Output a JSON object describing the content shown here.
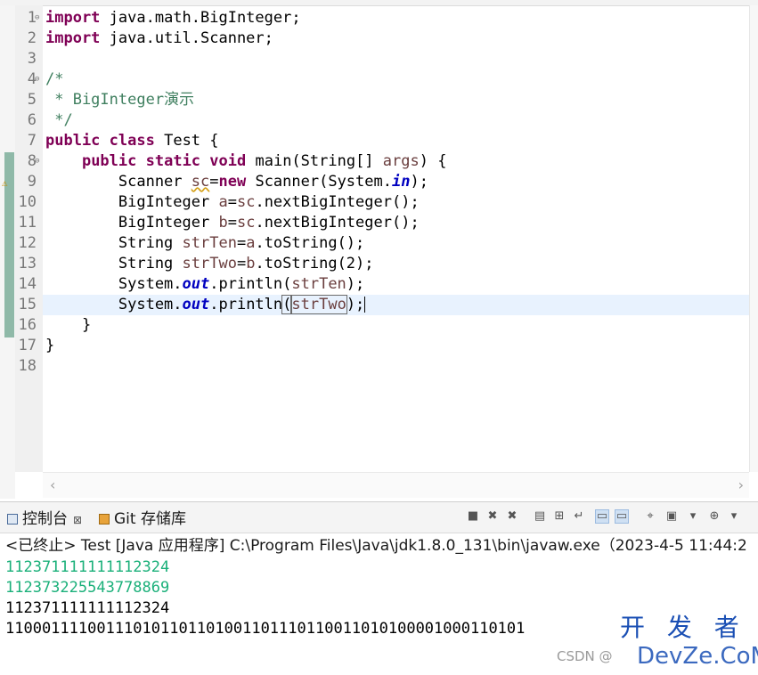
{
  "editor": {
    "lines": [
      {
        "n": "1",
        "fold": "⊖",
        "tokens": [
          {
            "t": "import",
            "c": "kw"
          },
          {
            "t": " java.math.BigInteger;",
            "c": ""
          }
        ]
      },
      {
        "n": "2",
        "fold": "",
        "tokens": [
          {
            "t": "import",
            "c": "kw"
          },
          {
            "t": " java.util.Scanner;",
            "c": ""
          }
        ]
      },
      {
        "n": "3",
        "fold": "",
        "tokens": []
      },
      {
        "n": "4",
        "fold": "⊖",
        "tokens": [
          {
            "t": "/*",
            "c": "cm"
          }
        ]
      },
      {
        "n": "5",
        "fold": "",
        "tokens": [
          {
            "t": " * BigInteger演示",
            "c": "cm"
          }
        ]
      },
      {
        "n": "6",
        "fold": "",
        "tokens": [
          {
            "t": " */",
            "c": "cm"
          }
        ]
      },
      {
        "n": "7",
        "fold": "",
        "tokens": [
          {
            "t": "public",
            "c": "kw"
          },
          {
            "t": " ",
            "c": ""
          },
          {
            "t": "class",
            "c": "kw"
          },
          {
            "t": " Test {",
            "c": ""
          }
        ]
      },
      {
        "n": "8",
        "fold": "⊖",
        "tokens": [
          {
            "t": "    ",
            "c": ""
          },
          {
            "t": "public",
            "c": "kw"
          },
          {
            "t": " ",
            "c": ""
          },
          {
            "t": "static",
            "c": "kw"
          },
          {
            "t": " ",
            "c": ""
          },
          {
            "t": "void",
            "c": "kw"
          },
          {
            "t": " main(String[] ",
            "c": ""
          },
          {
            "t": "args",
            "c": "var"
          },
          {
            "t": ") {",
            "c": ""
          }
        ]
      },
      {
        "n": "9",
        "fold": "",
        "tokens": [
          {
            "t": "        Scanner ",
            "c": ""
          },
          {
            "t": "sc",
            "c": "var wavy"
          },
          {
            "t": "=",
            "c": ""
          },
          {
            "t": "new",
            "c": "kw"
          },
          {
            "t": " Scanner(System.",
            "c": ""
          },
          {
            "t": "in",
            "c": "fld"
          },
          {
            "t": ");",
            "c": ""
          }
        ]
      },
      {
        "n": "10",
        "fold": "",
        "tokens": [
          {
            "t": "        BigInteger ",
            "c": ""
          },
          {
            "t": "a",
            "c": "var"
          },
          {
            "t": "=",
            "c": ""
          },
          {
            "t": "sc",
            "c": "var"
          },
          {
            "t": ".nextBigInteger();",
            "c": ""
          }
        ]
      },
      {
        "n": "11",
        "fold": "",
        "tokens": [
          {
            "t": "        BigInteger ",
            "c": ""
          },
          {
            "t": "b",
            "c": "var"
          },
          {
            "t": "=",
            "c": ""
          },
          {
            "t": "sc",
            "c": "var"
          },
          {
            "t": ".nextBigInteger();",
            "c": ""
          }
        ]
      },
      {
        "n": "12",
        "fold": "",
        "tokens": [
          {
            "t": "        String ",
            "c": ""
          },
          {
            "t": "strTen",
            "c": "var"
          },
          {
            "t": "=",
            "c": ""
          },
          {
            "t": "a",
            "c": "var"
          },
          {
            "t": ".toString();",
            "c": ""
          }
        ]
      },
      {
        "n": "13",
        "fold": "",
        "tokens": [
          {
            "t": "        String ",
            "c": ""
          },
          {
            "t": "strTwo",
            "c": "var"
          },
          {
            "t": "=",
            "c": ""
          },
          {
            "t": "b",
            "c": "var"
          },
          {
            "t": ".toString(2);",
            "c": ""
          }
        ]
      },
      {
        "n": "14",
        "fold": "",
        "tokens": [
          {
            "t": "        System.",
            "c": ""
          },
          {
            "t": "out",
            "c": "fld"
          },
          {
            "t": ".println(",
            "c": ""
          },
          {
            "t": "strTen",
            "c": "var"
          },
          {
            "t": ");",
            "c": ""
          }
        ]
      },
      {
        "n": "15",
        "fold": "",
        "current": true,
        "tokens": [
          {
            "t": "        System.",
            "c": ""
          },
          {
            "t": "out",
            "c": "fld"
          },
          {
            "t": ".println",
            "c": ""
          },
          {
            "t": "(",
            "c": "boxed"
          },
          {
            "t": "strTwo",
            "c": "var boxed"
          },
          {
            "t": ");",
            "c": ""
          }
        ]
      },
      {
        "n": "16",
        "fold": "",
        "tokens": [
          {
            "t": "    }",
            "c": ""
          }
        ]
      },
      {
        "n": "17",
        "fold": "",
        "tokens": [
          {
            "t": "}",
            "c": ""
          }
        ]
      },
      {
        "n": "18",
        "fold": "",
        "tokens": []
      }
    ]
  },
  "console": {
    "tabs": [
      {
        "label": "控制台",
        "icon": "console-icon",
        "close": "⊠"
      },
      {
        "label": "Git 存储库",
        "icon": "git-repo-icon"
      }
    ],
    "toolbar_icons": [
      "terminate-icon",
      "remove-launch-icon",
      "remove-all-terminated-icon",
      "clear-console-icon",
      "scroll-lock-icon",
      "word-wrap-icon",
      "show-on-stdout-icon",
      "show-on-stderr-icon",
      "pin-console-icon",
      "display-selected-console-icon",
      "display-dropdown-icon",
      "open-console-icon",
      "open-console-dropdown-icon"
    ],
    "status": "<已终止> Test [Java 应用程序] C:\\Program Files\\Java\\jdk1.8.0_131\\bin\\javaw.exe（2023-4-5 11:44:2",
    "output": [
      {
        "text": "112371111111112324",
        "color": "green"
      },
      {
        "text": "112373225543778869",
        "color": "green"
      },
      {
        "text": "112371111111112324",
        "color": "black"
      },
      {
        "text": "110001111001110101101101001101110110011010100001000110101",
        "color": "black"
      }
    ]
  },
  "watermark": {
    "brand": "开 发 者",
    "domain": "DevZe.CoM",
    "csdn": "CSDN @"
  }
}
